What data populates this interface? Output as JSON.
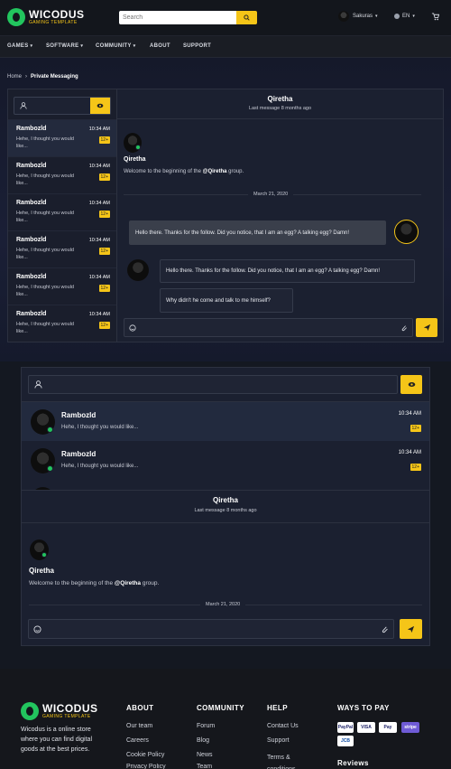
{
  "header": {
    "logo_title": "WICODUS",
    "logo_subtitle": "GAMING TEMPLATE",
    "search_placeholder": "Search",
    "username": "Sakuras",
    "language": "EN"
  },
  "nav": {
    "items": [
      "GAMES",
      "SOFTWARE",
      "COMMUNITY",
      "ABOUT",
      "SUPPORT"
    ]
  },
  "breadcrumb": {
    "home": "Home",
    "current": "Private Messaging"
  },
  "conversations": [
    {
      "name": "Rambozld",
      "preview": "Hehe, I thought you would like...",
      "time": "10:34 AM",
      "badge": "12+"
    },
    {
      "name": "Rambozld",
      "preview": "Hehe, I thought you would like...",
      "time": "10:34 AM",
      "badge": "12+"
    },
    {
      "name": "Rambozld",
      "preview": "Hehe, I thought you would like...",
      "time": "10:34 AM",
      "badge": "12+"
    },
    {
      "name": "Rambozld",
      "preview": "Hehe, I thought you would like...",
      "time": "10:34 AM",
      "badge": "12+"
    },
    {
      "name": "Rambozld",
      "preview": "Hehe, I thought you would like...",
      "time": "10:34 AM",
      "badge": "12+"
    },
    {
      "name": "Rambozld",
      "preview": "Hehe, I thought you would like...",
      "time": "10:34 AM",
      "badge": "12+"
    }
  ],
  "chat": {
    "title": "Qiretha",
    "subtitle": "Last message 8 months ago",
    "group_name": "Qiretha",
    "welcome_prefix": "Welcome to the beginning of the ",
    "welcome_group": "@Qiretha",
    "welcome_suffix": " group.",
    "date": "March 21, 2020",
    "messages": [
      {
        "text": "Hello there. Thanks for the follow. Did you notice, that I am an egg? A talking egg? Damn!"
      },
      {
        "text": "Hello there. Thanks for the follow. Did you notice, that I am an egg? A talking egg? Damn!"
      },
      {
        "text": "Why didn't he come and talk to me himself?"
      }
    ]
  },
  "footer": {
    "brand": "WICODUS",
    "brand_sub": "GAMING TEMPLATE",
    "description": "Wicodus is a online store where you can find digital goods at the best prices.",
    "about_title": "ABOUT",
    "about_links": [
      "Our team",
      "Careers",
      "Cookie Policy",
      "Privacy Policy"
    ],
    "community_title": "COMMUNITY",
    "community_links": [
      "Forum",
      "Blog",
      "News",
      "Team"
    ],
    "help_title": "HELP",
    "help_links": [
      "Contact Us",
      "Support",
      "Terms & conditions"
    ],
    "pay_title": "WAYS TO PAY",
    "pay_methods": [
      "PayPal",
      "VISA",
      "Pay",
      "stripe",
      "JCB"
    ],
    "reviews_title": "Reviews"
  },
  "colors": {
    "accent": "#f5c518",
    "online": "#22c55e",
    "bg": "#141821",
    "panel": "#1b2030"
  }
}
